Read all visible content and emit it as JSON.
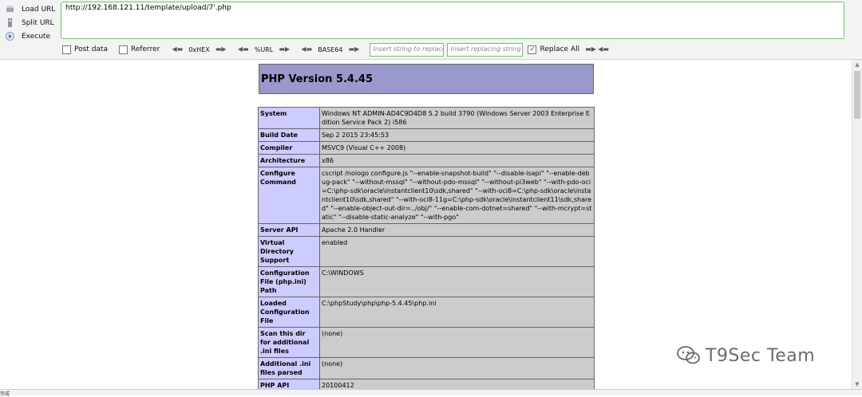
{
  "toolbar": {
    "load_url": "Load URL",
    "split_url": "Split URL",
    "execute": "Execute",
    "url_value": "http://192.168.121.11/template/upload/7'.php",
    "post_data": "Post data",
    "referrer": "Referrer",
    "hex": "0xHEX",
    "url_enc": "%URL",
    "base64": "BASE64",
    "insert_placeholder": "Insert string to replace",
    "replacing_placeholder": "Insert replacing string",
    "replace_all": "Replace All"
  },
  "php": {
    "version_title": "PHP Version 5.4.45",
    "rows": [
      {
        "key": "System",
        "value": "Windows NT ADMIN-AD4C9D4D8 5.2 build 3790 (Windows Server 2003 Enterprise Edition Service Pack 2) i586"
      },
      {
        "key": "Build Date",
        "value": "Sep 2 2015 23:45:53"
      },
      {
        "key": "Compiler",
        "value": "MSVC9 (Visual C++ 2008)"
      },
      {
        "key": "Architecture",
        "value": "x86"
      },
      {
        "key": "Configure Command",
        "value": "cscript /nologo configure.js \"--enable-snapshot-build\" \"--disable-isapi\" \"--enable-debug-pack\" \"--without-mssql\" \"--without-pdo-mssql\" \"--without-pi3web\" \"--with-pdo-oci=C:\\php-sdk\\oracle\\instantclient10\\sdk,shared\" \"--with-oci8=C:\\php-sdk\\oracle\\instantclient10\\sdk,shared\" \"--with-oci8-11g=C:\\php-sdk\\oracle\\instantclient11\\sdk,shared\" \"--enable-object-out-dir=../obj/\" \"--enable-com-dotnet=shared\" \"--with-mcrypt=static\" \"--disable-static-analyze\" \"--with-pgo\""
      },
      {
        "key": "Server API",
        "value": "Apache 2.0 Handler"
      },
      {
        "key": "Virtual Directory Support",
        "value": "enabled"
      },
      {
        "key": "Configuration File (php.ini) Path",
        "value": "C:\\WINDOWS"
      },
      {
        "key": "Loaded Configuration File",
        "value": "C:\\phpStudy\\php\\php-5.4.45\\php.ini"
      },
      {
        "key": "Scan this dir for additional .ini files",
        "value": "(none)"
      },
      {
        "key": "Additional .ini files parsed",
        "value": "(none)"
      },
      {
        "key": "PHP API",
        "value": "20100412"
      }
    ]
  },
  "watermark": {
    "text": "T9Sec Team"
  },
  "status": {
    "text": "完成"
  },
  "colors": {
    "header_bg": "#9999cc",
    "key_bg": "#ccccff",
    "value_bg": "#cccccc",
    "accent_green": "#6fbf6f"
  }
}
